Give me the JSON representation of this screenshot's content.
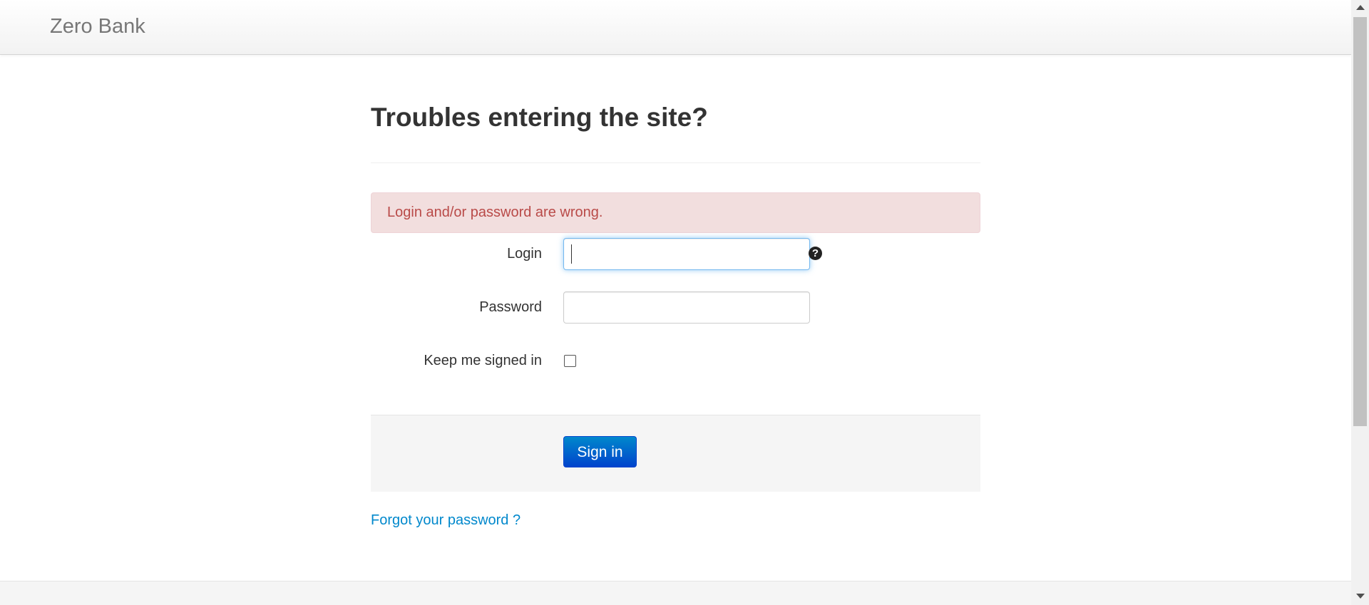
{
  "navbar": {
    "brand": "Zero Bank"
  },
  "page": {
    "title": "Troubles entering the site?"
  },
  "alert": {
    "message": "Login and/or password are wrong."
  },
  "form": {
    "login_label": "Login",
    "login_value": "",
    "password_label": "Password",
    "password_value": "",
    "remember_label": "Keep me signed in",
    "remember_checked": false,
    "help_icon": "question-circle-icon",
    "submit_label": "Sign in"
  },
  "links": {
    "forgot_password": "Forgot your password ?"
  },
  "colors": {
    "alert_bg": "#f2dede",
    "alert_text": "#b94a48",
    "primary_button": "#0055cc",
    "link": "#0088cc"
  }
}
